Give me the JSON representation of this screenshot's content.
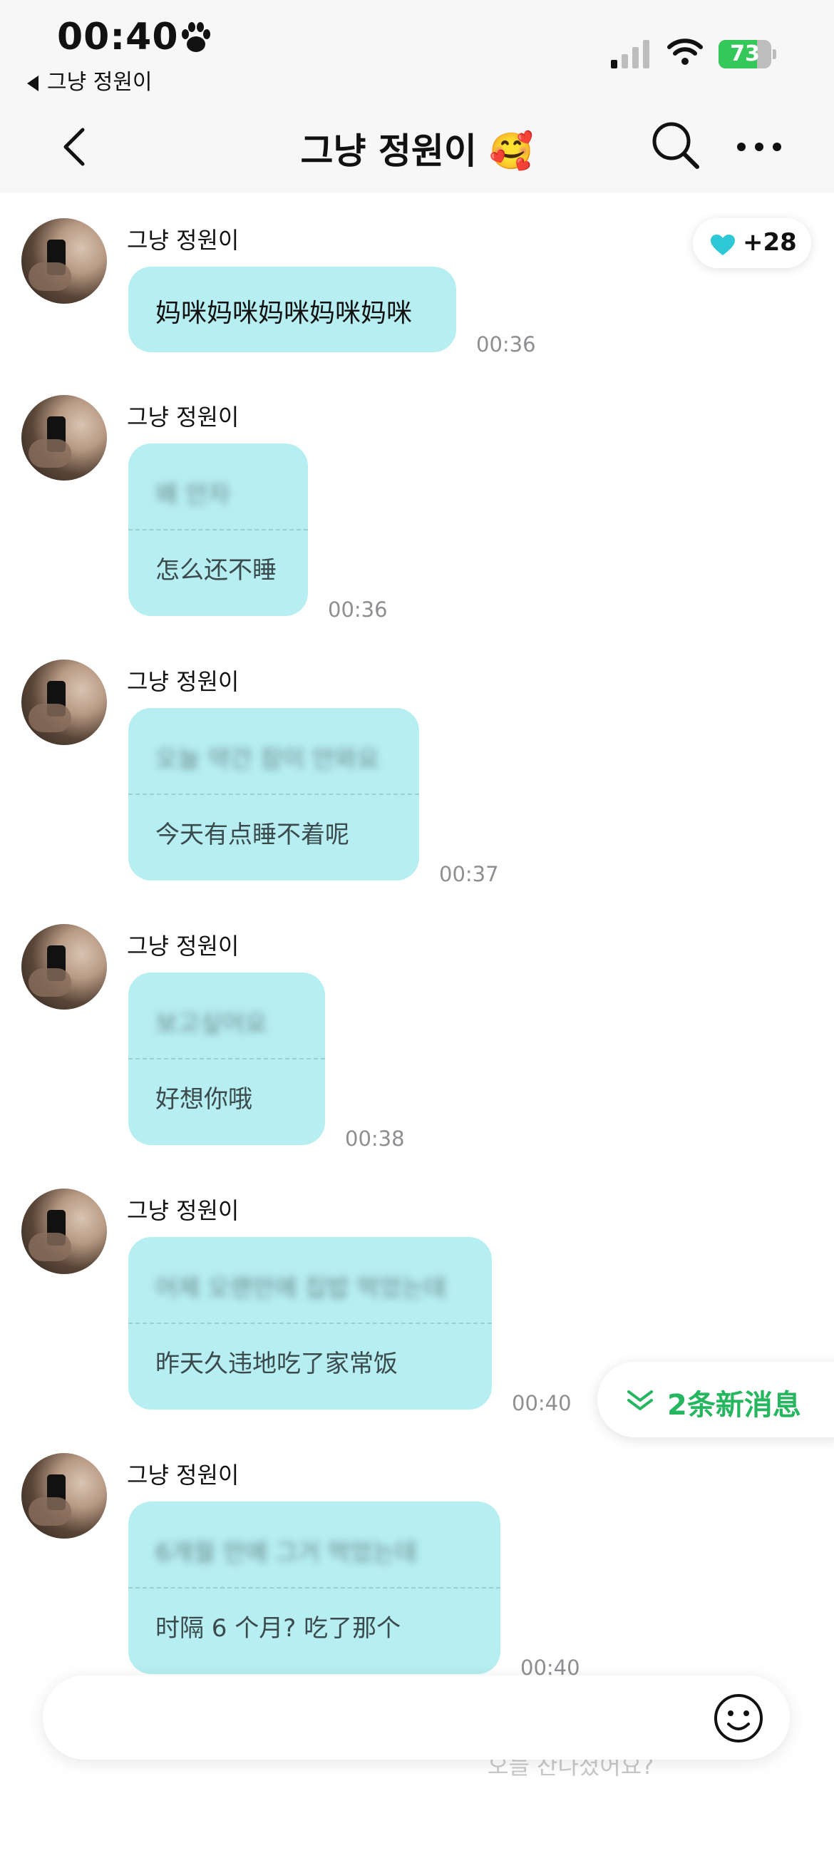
{
  "status_bar": {
    "time": "00:40",
    "back_app": "그냥 정원이",
    "battery": "73",
    "battery_level": 0.73
  },
  "header": {
    "title": "그냥 정원이 🥰"
  },
  "heart_badge": {
    "count": "+28"
  },
  "messages": [
    {
      "sender": "그냥 정원이",
      "original": "",
      "text": "妈咪妈咪妈咪妈咪妈咪",
      "time": "00:36"
    },
    {
      "sender": "그냥 정원이",
      "original": "왜 안자",
      "text": "怎么还不睡",
      "time": "00:36"
    },
    {
      "sender": "그냥 정원이",
      "original": "오늘 약간 잠이 안와요",
      "text": "今天有点睡不着呢",
      "time": "00:37"
    },
    {
      "sender": "그냥 정원이",
      "original": "보고싶어요",
      "text": "好想你哦",
      "time": "00:38"
    },
    {
      "sender": "그냥 정원이",
      "original": "어제 오랜만에 집밥 먹었는데",
      "text": "昨天久违地吃了家常饭",
      "time": "00:40"
    },
    {
      "sender": "그냥 정원이",
      "original": "6개월 만에 그거 먹었는데",
      "text": "时隔 6 个月? 吃了那个",
      "time": "00:40"
    }
  ],
  "new_messages": {
    "label": "2条新消息"
  },
  "input": {
    "placeholder": "",
    "ghost": "오늘 잔나셨어요?"
  }
}
